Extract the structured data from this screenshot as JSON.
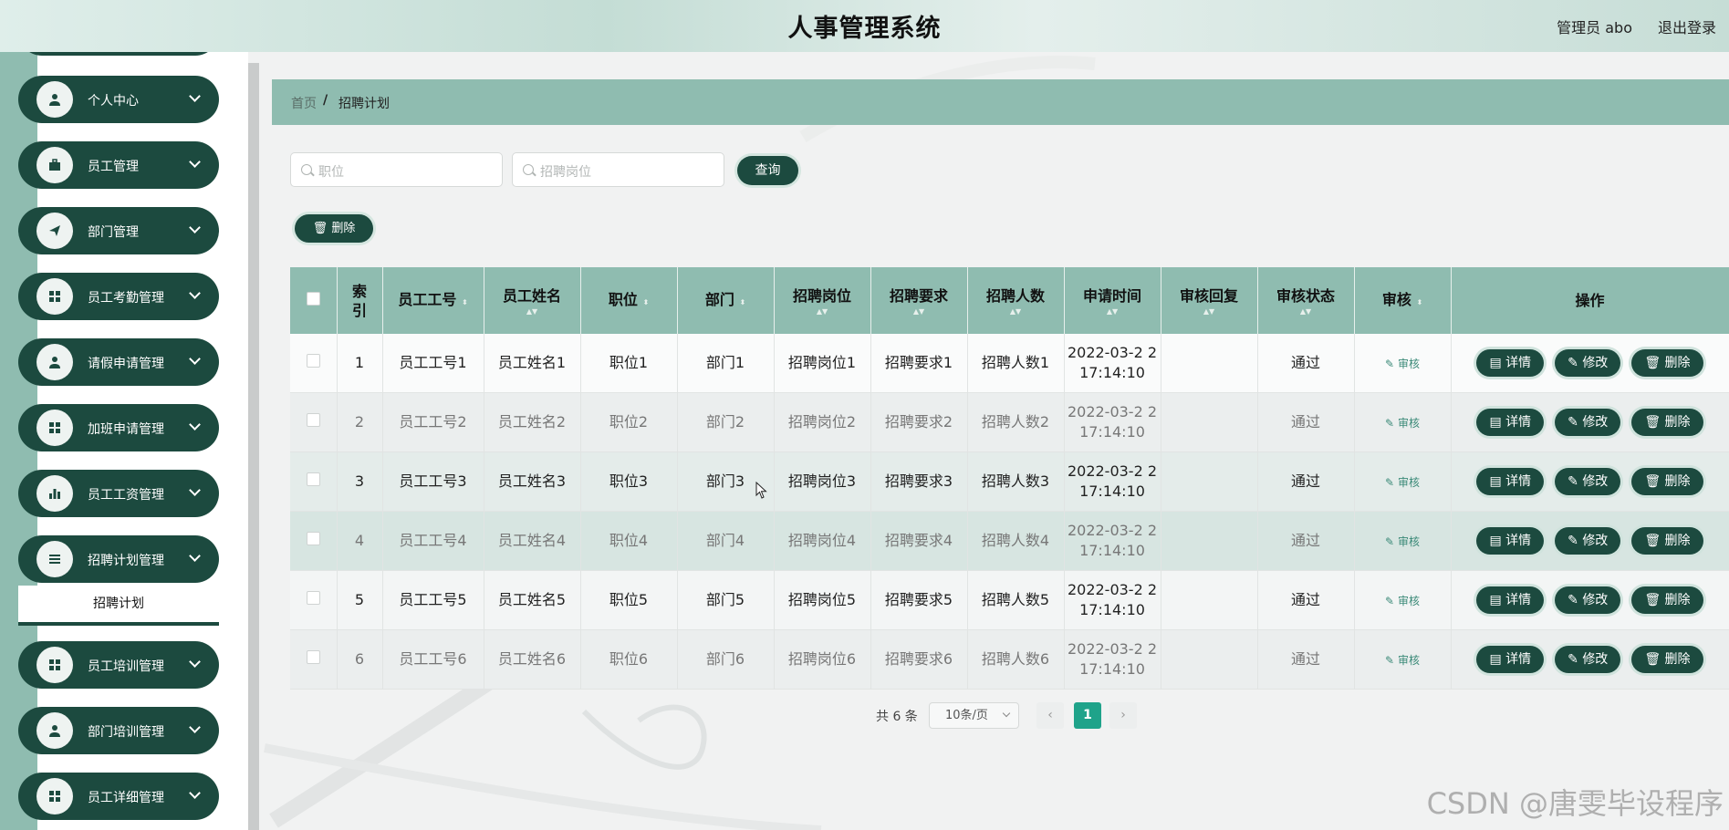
{
  "header": {
    "title": "人事管理系统",
    "user": "管理员 abo",
    "logout": "退出登录"
  },
  "sidebar": {
    "items": [
      {
        "label": "个人中心",
        "icon": "user-icon"
      },
      {
        "label": "员工管理",
        "icon": "briefcase-icon"
      },
      {
        "label": "部门管理",
        "icon": "paper-plane-icon"
      },
      {
        "label": "员工考勤管理",
        "icon": "grid-icon"
      },
      {
        "label": "请假申请管理",
        "icon": "user-icon"
      },
      {
        "label": "加班申请管理",
        "icon": "grid-icon"
      },
      {
        "label": "员工工资管理",
        "icon": "bar-chart-icon"
      },
      {
        "label": "招聘计划管理",
        "icon": "list-icon"
      },
      {
        "label": "员工培训管理",
        "icon": "grid-icon"
      },
      {
        "label": "部门培训管理",
        "icon": "user-icon"
      },
      {
        "label": "员工详细管理",
        "icon": "grid-icon"
      }
    ],
    "submenu": "招聘计划"
  },
  "breadcrumb": {
    "home": "首页",
    "separator": "/",
    "current": "招聘计划"
  },
  "search": {
    "position_placeholder": "职位",
    "post_placeholder": "招聘岗位",
    "query_label": "查询"
  },
  "toolbar": {
    "delete_label": "删除"
  },
  "table": {
    "headers": {
      "index": "索引",
      "emp_no": "员工工号",
      "emp_name": "员工姓名",
      "position": "职位",
      "dept": "部门",
      "post": "招聘岗位",
      "requirement": "招聘要求",
      "count": "招聘人数",
      "apply_time": "申请时间",
      "reply": "审核回复",
      "status": "审核状态",
      "audit": "审核",
      "ops": "操作"
    },
    "rows": [
      {
        "index": "1",
        "emp_no": "员工工号1",
        "emp_name": "员工姓名1",
        "position": "职位1",
        "dept": "部门1",
        "post": "招聘岗位1",
        "requirement": "招聘要求1",
        "count": "招聘人数1",
        "apply_time": "2022-03-2 2 17:14:10",
        "reply": "",
        "status": "通过",
        "audit": "审核"
      },
      {
        "index": "2",
        "emp_no": "员工工号2",
        "emp_name": "员工姓名2",
        "position": "职位2",
        "dept": "部门2",
        "post": "招聘岗位2",
        "requirement": "招聘要求2",
        "count": "招聘人数2",
        "apply_time": "2022-03-2 2 17:14:10",
        "reply": "",
        "status": "通过",
        "audit": "审核"
      },
      {
        "index": "3",
        "emp_no": "员工工号3",
        "emp_name": "员工姓名3",
        "position": "职位3",
        "dept": "部门3",
        "post": "招聘岗位3",
        "requirement": "招聘要求3",
        "count": "招聘人数3",
        "apply_time": "2022-03-2 2 17:14:10",
        "reply": "",
        "status": "通过",
        "audit": "审核"
      },
      {
        "index": "4",
        "emp_no": "员工工号4",
        "emp_name": "员工姓名4",
        "position": "职位4",
        "dept": "部门4",
        "post": "招聘岗位4",
        "requirement": "招聘要求4",
        "count": "招聘人数4",
        "apply_time": "2022-03-2 2 17:14:10",
        "reply": "",
        "status": "通过",
        "audit": "审核"
      },
      {
        "index": "5",
        "emp_no": "员工工号5",
        "emp_name": "员工姓名5",
        "position": "职位5",
        "dept": "部门5",
        "post": "招聘岗位5",
        "requirement": "招聘要求5",
        "count": "招聘人数5",
        "apply_time": "2022-03-2 2 17:14:10",
        "reply": "",
        "status": "通过",
        "audit": "审核"
      },
      {
        "index": "6",
        "emp_no": "员工工号6",
        "emp_name": "员工姓名6",
        "position": "职位6",
        "dept": "部门6",
        "post": "招聘岗位6",
        "requirement": "招聘要求6",
        "count": "招聘人数6",
        "apply_time": "2022-03-2 2 17:14:10",
        "reply": "",
        "status": "通过",
        "audit": "审核"
      }
    ],
    "actions": {
      "detail": "详情",
      "edit": "修改",
      "delete": "删除"
    }
  },
  "pagination": {
    "total": "共 6 条",
    "page_size": "10条/页",
    "current": "1",
    "prev": "‹",
    "next": "›"
  },
  "watermark": "CSDN @唐雯毕设程序",
  "colors": {
    "primary": "#1c4a3f",
    "header_bg": "#8fbcb0",
    "page_active": "#1fa38a"
  }
}
